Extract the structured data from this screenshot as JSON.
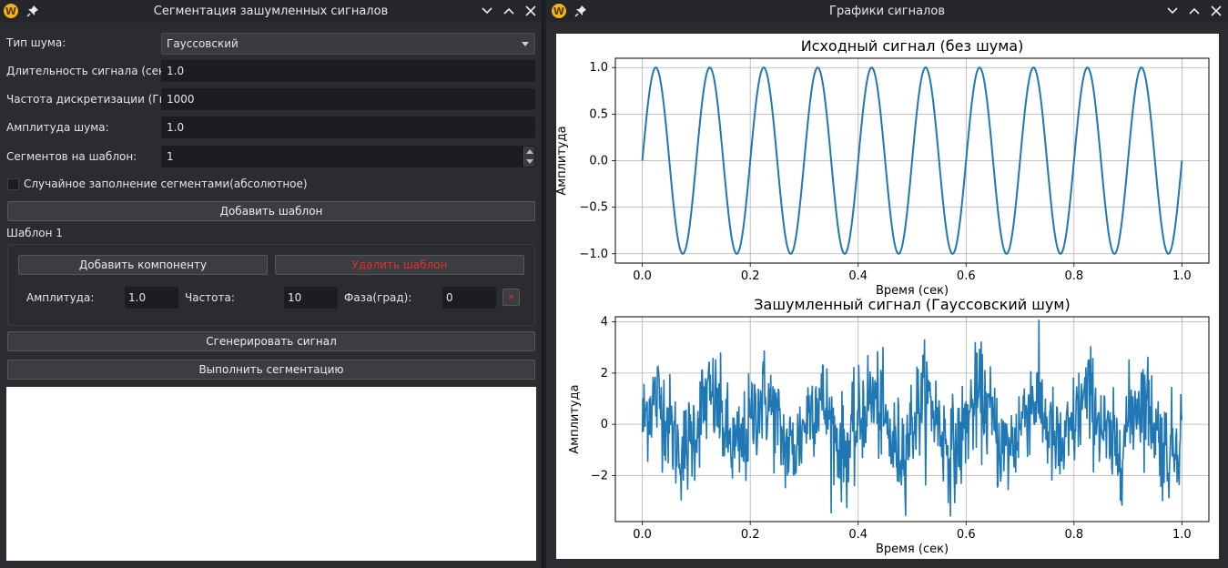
{
  "left_window": {
    "title": "Сегментация зашумленных сигналов",
    "icons": {
      "app": "app-logo-icon",
      "pin": "pin-icon",
      "minimize": "chevron-down-icon",
      "maximize": "chevron-up-icon",
      "close": "close-icon"
    },
    "form": {
      "noise_type_label": "Тип шума:",
      "noise_type_value": "Гауссовский",
      "duration_label": "Длительность сигнала (сек):",
      "duration_value": "1.0",
      "sampling_label": "Частота дискретизации (Гц):",
      "sampling_value": "1000",
      "noise_amp_label": "Амплитуда шума:",
      "noise_amp_value": "1.0",
      "segments_label": "Сегментов на шаблон:",
      "segments_value": "1",
      "random_fill_label": "Случайное заполнение сегментами(абсолютное)",
      "random_fill_checked": false
    },
    "add_template_button": "Добавить шаблон",
    "template": {
      "title": "Шаблон 1",
      "add_component_button": "Добавить компоненту",
      "delete_template_button": "Удалить шаблон",
      "amplitude_label": "Амплитуда:",
      "amplitude_value": "1.0",
      "frequency_label": "Частота:",
      "frequency_value": "10",
      "phase_label": "Фаза(град):",
      "phase_value": "0",
      "remove_component_symbol": "×"
    },
    "generate_button": "Сгенерировать сигнал",
    "segment_button": "Выполнить сегментацию",
    "accent_delete_color": "#e03030"
  },
  "right_window": {
    "title": "Графики сигналов",
    "icons": {
      "app": "app-logo-icon",
      "pin": "pin-icon",
      "minimize": "chevron-down-icon",
      "maximize": "chevron-up-icon",
      "close": "close-icon"
    }
  },
  "chart_data": [
    {
      "type": "line",
      "title": "Исходный сигнал (без шума)",
      "xlabel": "Время (сек)",
      "ylabel": "Амплитуда",
      "xlim": [
        -0.05,
        1.05
      ],
      "ylim": [
        -1.1,
        1.1
      ],
      "xticks": [
        "0.0",
        "0.2",
        "0.4",
        "0.6",
        "0.8",
        "1.0"
      ],
      "yticks": [
        "−1.0",
        "−0.5",
        "0.0",
        "0.5",
        "1.0"
      ],
      "ytick_values": [
        -1.0,
        -0.5,
        0.0,
        0.5,
        1.0
      ],
      "xtick_values": [
        0.0,
        0.2,
        0.4,
        0.6,
        0.8,
        1.0
      ],
      "grid": true,
      "series": [
        {
          "function": "sin",
          "amplitude": 1.0,
          "frequency_hz": 10,
          "phase_deg": 0,
          "x_range": [
            0,
            1
          ],
          "color": "#1f77b4"
        }
      ]
    },
    {
      "type": "line",
      "title": "Зашумленный сигнал (Гауссовский шум)",
      "xlabel": "Время (сек)",
      "ylabel": "Амплитуда",
      "xlim": [
        -0.05,
        1.05
      ],
      "ylim": [
        -3.8,
        4.2
      ],
      "xticks": [
        "0.0",
        "0.2",
        "0.4",
        "0.6",
        "0.8",
        "1.0"
      ],
      "yticks": [
        "−2",
        "0",
        "2",
        "4"
      ],
      "ytick_values": [
        -2,
        0,
        2,
        4
      ],
      "xtick_values": [
        0.0,
        0.2,
        0.4,
        0.6,
        0.8,
        1.0
      ],
      "grid": true,
      "series": [
        {
          "function": "sin + gaussian noise",
          "amplitude": 1.0,
          "frequency_hz": 10,
          "noise_std": 1.0,
          "x_range": [
            0,
            1
          ],
          "color": "#1f77b4"
        }
      ]
    }
  ]
}
